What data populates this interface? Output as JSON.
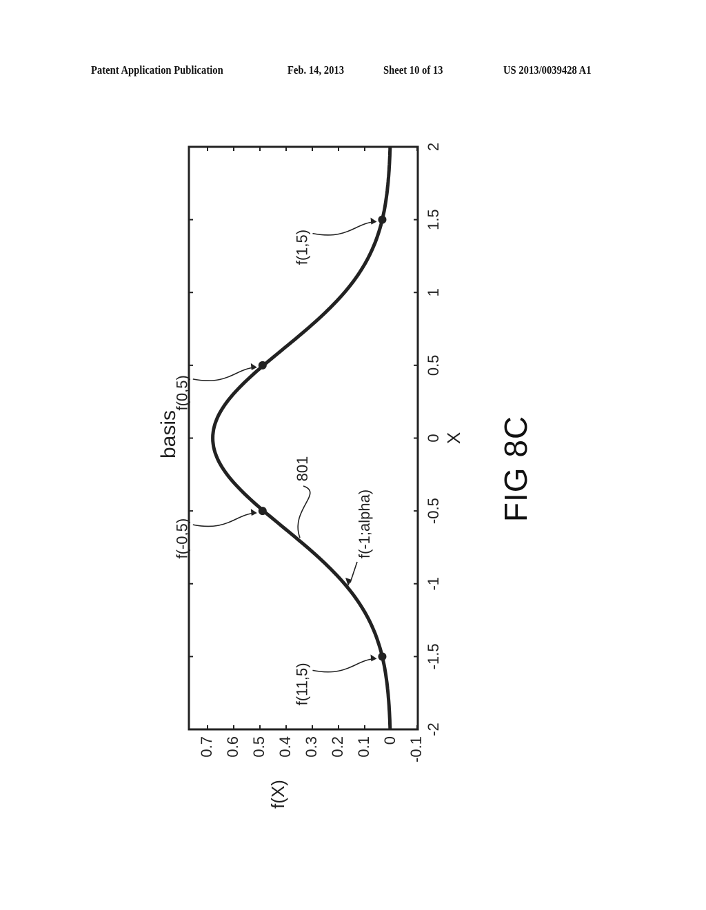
{
  "header": {
    "publication": "Patent Application Publication",
    "date": "Feb. 14, 2013",
    "sheet": "Sheet 10 of 13",
    "number": "US 2013/0039428 A1"
  },
  "figure_label": "FIG 8C",
  "chart_data": {
    "type": "line",
    "orientation": "rotated 90° counter-clockwise",
    "title": "basis",
    "xlabel": "X",
    "ylabel": "f(X)",
    "xlim": [
      -2,
      2
    ],
    "ylim": [
      -0.1,
      0.77
    ],
    "xticks": [
      "-2",
      "-1.5",
      "-1",
      "-0.5",
      "0",
      "0.5",
      "1",
      "1.5",
      "2"
    ],
    "yticks": [
      "-0.1",
      "0",
      "0.1",
      "0.2",
      "0.3",
      "0.4",
      "0.5",
      "0.6",
      "0.7"
    ],
    "grid": false,
    "series": [
      {
        "name": "f(-1;alpha)",
        "reference": "801",
        "x": [
          -2,
          -1.75,
          -1.5,
          -1.25,
          -1,
          -0.75,
          -0.5,
          -0.25,
          0,
          0.25,
          0.5,
          0.75,
          1,
          1.25,
          1.5,
          1.75,
          2
        ],
        "y": [
          0.003,
          0.011,
          0.033,
          0.083,
          0.178,
          0.323,
          0.49,
          0.625,
          0.68,
          0.625,
          0.49,
          0.323,
          0.178,
          0.083,
          0.033,
          0.011,
          0.003
        ]
      }
    ],
    "markers": [
      {
        "label": "f(11,5)",
        "x": -1.5,
        "y": 0.033
      },
      {
        "label": "f(-0,5)",
        "x": -0.5,
        "y": 0.49
      },
      {
        "label": "f(0,5)",
        "x": 0.5,
        "y": 0.49
      },
      {
        "label": "f(1,5)",
        "x": 1.5,
        "y": 0.033
      }
    ],
    "annotations": [
      {
        "label": "801",
        "x": -0.7,
        "y": 0.36
      },
      {
        "label": "f(-1;alpha)",
        "x": -0.95,
        "y": 0.2
      }
    ]
  }
}
